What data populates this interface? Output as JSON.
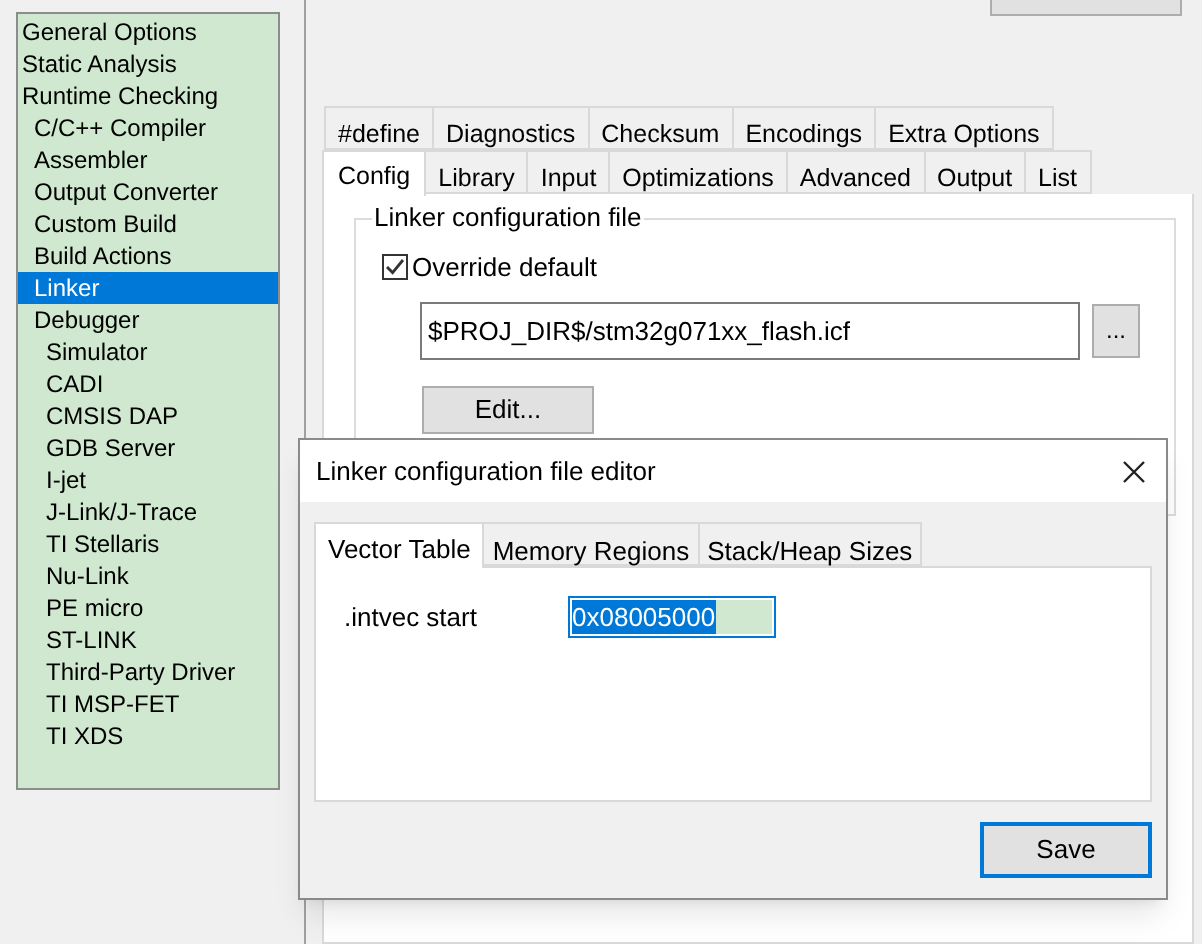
{
  "sidebar": {
    "items": [
      {
        "label": "General Options",
        "selected": false
      },
      {
        "label": "Static Analysis",
        "selected": false
      },
      {
        "label": "Runtime Checking",
        "selected": false,
        "children": [
          {
            "label": "C/C++ Compiler",
            "selected": false
          },
          {
            "label": "Assembler",
            "selected": false
          },
          {
            "label": "Output Converter",
            "selected": false
          },
          {
            "label": "Custom Build",
            "selected": false
          },
          {
            "label": "Build Actions",
            "selected": false
          },
          {
            "label": "Linker",
            "selected": true
          },
          {
            "label": "Debugger",
            "selected": false,
            "children": [
              {
                "label": "Simulator",
                "selected": false
              },
              {
                "label": "CADI",
                "selected": false
              },
              {
                "label": "CMSIS DAP",
                "selected": false
              },
              {
                "label": "GDB Server",
                "selected": false
              },
              {
                "label": "I-jet",
                "selected": false
              },
              {
                "label": "J-Link/J-Trace",
                "selected": false
              },
              {
                "label": "TI Stellaris",
                "selected": false
              },
              {
                "label": "Nu-Link",
                "selected": false
              },
              {
                "label": "PE micro",
                "selected": false
              },
              {
                "label": "ST-LINK",
                "selected": false
              },
              {
                "label": "Third-Party Driver",
                "selected": false
              },
              {
                "label": "TI MSP-FET",
                "selected": false
              },
              {
                "label": "TI XDS",
                "selected": false
              }
            ]
          }
        ]
      }
    ]
  },
  "tab_rows": [
    [
      {
        "label": "#define",
        "selected": false
      },
      {
        "label": "Diagnostics",
        "selected": false
      },
      {
        "label": "Checksum",
        "selected": false
      },
      {
        "label": "Encodings",
        "selected": false
      },
      {
        "label": "Extra Options",
        "selected": false
      }
    ],
    [
      {
        "label": "Config",
        "selected": true
      },
      {
        "label": "Library",
        "selected": false
      },
      {
        "label": "Input",
        "selected": false
      },
      {
        "label": "Optimizations",
        "selected": false
      },
      {
        "label": "Advanced",
        "selected": false
      },
      {
        "label": "Output",
        "selected": false
      },
      {
        "label": "List",
        "selected": false
      }
    ]
  ],
  "linker_group": {
    "title": "Linker configuration file",
    "override": {
      "label": "Override default",
      "checked": true
    },
    "path": {
      "value": "$PROJ_DIR$/stm32g071xx_flash.icf"
    },
    "browse_button": "...",
    "edit_button": "Edit..."
  },
  "dialog": {
    "title": "Linker configuration file editor",
    "tabs": [
      {
        "label": "Vector Table",
        "selected": true
      },
      {
        "label": "Memory Regions",
        "selected": false
      },
      {
        "label": "Stack/Heap Sizes",
        "selected": false
      }
    ],
    "fields": [
      {
        "label": ".intvec start",
        "value": "0x08005000"
      }
    ],
    "save_button": "Save"
  }
}
